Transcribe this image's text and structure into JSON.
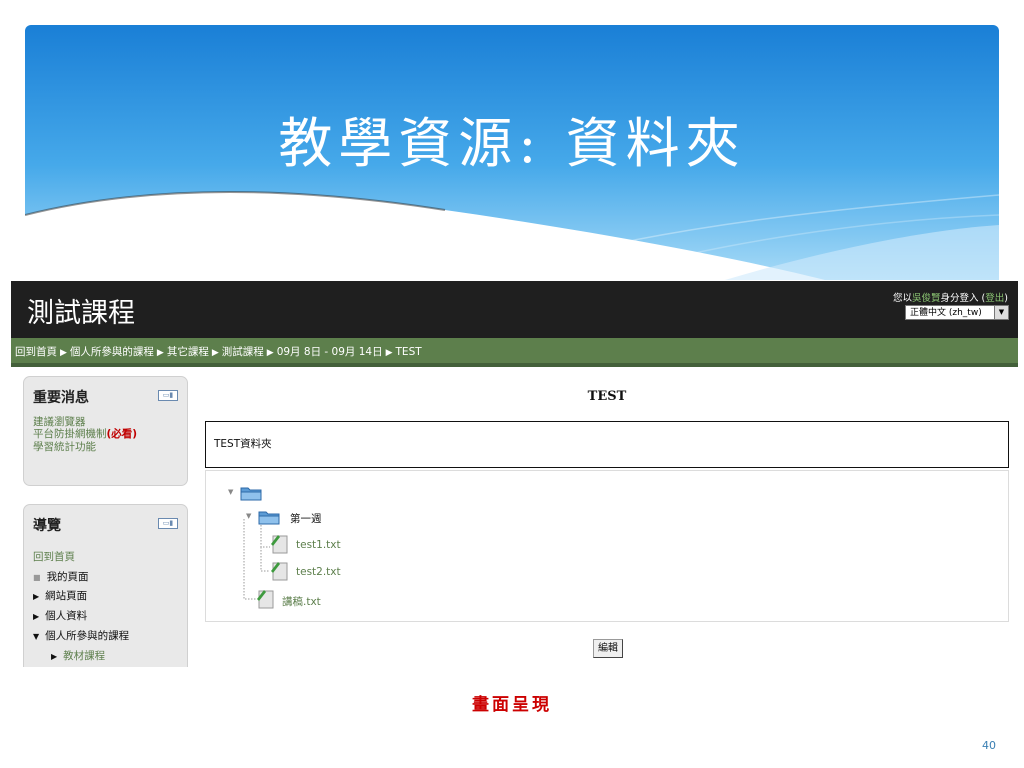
{
  "slide": {
    "title": "教學資源: 資料夾",
    "caption": "畫面呈現",
    "page_number": "40"
  },
  "colors": {
    "banner_top": "#1a7fd6",
    "banner_bottom": "#9bd3f5",
    "header_bg": "#1f1f1f",
    "nav_bar": "#5d7f4c",
    "link_green": "#5d7f4c",
    "caption_red": "#cc0000"
  },
  "moodle": {
    "course_title": "測試課程",
    "login": {
      "prefix": "您以",
      "user": "吳俊賢",
      "middle": "身分登入 (",
      "logout": "登出",
      "suffix": ")"
    },
    "language": "正體中文 (zh_tw)",
    "breadcrumbs": [
      "回到首頁",
      "個人所參與的課程",
      "其它課程",
      "測試課程",
      "09月 8日 - 09月 14日",
      "TEST"
    ],
    "news_block": {
      "title": "重要消息",
      "links": [
        "建議瀏覽器",
        "平台防掛網機制",
        "學習統計功能"
      ],
      "must_read": "(必看)"
    },
    "nav_block": {
      "title": "導覽",
      "home": "回到首頁",
      "items": [
        "我的頁面",
        "網站頁面",
        "個人資料",
        "個人所參與的課程",
        "教材課程"
      ]
    },
    "folder": {
      "name": "TEST",
      "description": "TEST資料夾",
      "subfolder": "第一週",
      "files": [
        "test1.txt",
        "test2.txt",
        "講稿.txt"
      ]
    },
    "edit_button": "編輯"
  }
}
